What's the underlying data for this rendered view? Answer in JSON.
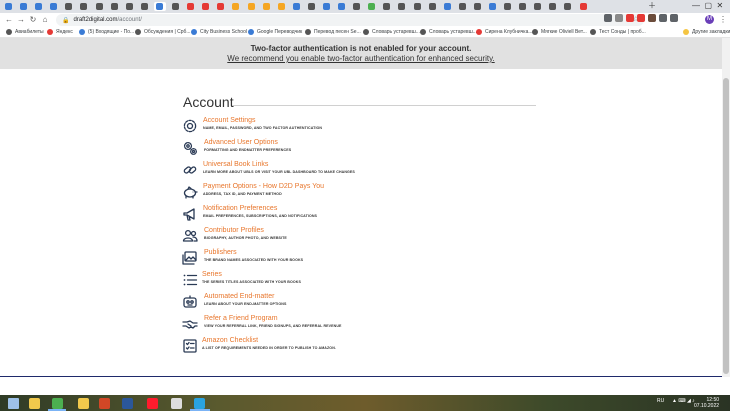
{
  "browser": {
    "url_domain": "draft2digital.com",
    "url_path": "/account/",
    "tab_colors": [
      "#3a7bd5",
      "#3a7bd5",
      "#3a7bd5",
      "#3a7bd5",
      "#555",
      "#555",
      "#555",
      "#555",
      "#555",
      "#555",
      "#3a7bd5",
      "#555",
      "#e53935",
      "#e53935",
      "#e53935",
      "#f5a623",
      "#f5a623",
      "#f5a623",
      "#f5a623",
      "#3a7bd5",
      "#555",
      "#3a7bd5",
      "#3a7bd5",
      "#555",
      "#4caf50",
      "#555",
      "#555",
      "#555",
      "#555",
      "#3a7bd5",
      "#555",
      "#555",
      "#3a7bd5",
      "#555",
      "#555",
      "#555",
      "#555",
      "#555",
      "#e53935"
    ],
    "bookmarks": [
      {
        "label": "Авиабилеты",
        "color": "#555555"
      },
      {
        "label": "Яндекс",
        "color": "#e53935"
      },
      {
        "label": "(5) Входящие - По...",
        "color": "#3a7bd5"
      },
      {
        "label": "Обсуждения | Срб...",
        "color": "#555555"
      },
      {
        "label": "City Business School",
        "color": "#3a7bd5"
      },
      {
        "label": "Google Переводчик",
        "color": "#3a7bd5"
      },
      {
        "label": "Перевод песен Se...",
        "color": "#555555"
      },
      {
        "label": "Словарь устаревш...",
        "color": "#555555"
      },
      {
        "label": "Словарь устаревш...",
        "color": "#555555"
      },
      {
        "label": "Сирена Клубничка...",
        "color": "#e53935"
      },
      {
        "label": "Мягкие Oliviell Вет...",
        "color": "#555555"
      },
      {
        "label": "Тест Сонды | проб...",
        "color": "#555555"
      },
      {
        "label": "Другие закладки",
        "color": "#f5c542"
      }
    ]
  },
  "alert": {
    "title": "Two-factor authentication is not enabled for your account.",
    "link": "We recommend you enable two-factor authentication for enhanced security."
  },
  "page_title": "Account",
  "items": [
    {
      "title": "Account Settings",
      "desc": "NAME, EMAIL, PASSWORD, AND TWO FACTOR AUTHENTICATION",
      "icon": "gear-icon"
    },
    {
      "title": "Advanced User Options",
      "desc": "FORMATTING AND ENDMATTER PREFERENCES",
      "icon": "gears-icon"
    },
    {
      "title": "Universal Book Links",
      "desc": "LEARN MORE ABOUT UBLS OR VISIT YOUR UBL DASHBOARD TO MAKE CHANGES",
      "icon": "link-icon"
    },
    {
      "title": "Payment Options - How D2D Pays You",
      "desc": "ADDRESS, TAX ID, AND PAYMENT METHOD",
      "icon": "piggy-bank-icon"
    },
    {
      "title": "Notification Preferences",
      "desc": "EMAIL PREFERENCES, SUBSCRIPTIONS, AND NOTIFICATIONS",
      "icon": "megaphone-icon"
    },
    {
      "title": "Contributor Profiles",
      "desc": "BIOGRAPHY, AUTHOR PHOTO, AND WEBSITE",
      "icon": "people-icon"
    },
    {
      "title": "Publishers",
      "desc": "THE BRAND NAMES ASSOCIATED WITH YOUR BOOKS",
      "icon": "image-icon"
    },
    {
      "title": "Series",
      "desc": "THE SERIES TITLES ASSOCIATED WITH YOUR BOOKS",
      "icon": "list-icon"
    },
    {
      "title": "Automated End-matter",
      "desc": "LEARN ABOUT YOUR END-MATTER OPTIONS",
      "icon": "robot-icon"
    },
    {
      "title": "Refer a Friend Program",
      "desc": "VIEW YOUR REFERRAL LINK, FRIEND SIGNUPS, AND REFERRAL REVENUE",
      "icon": "handshake-icon"
    },
    {
      "title": "Amazon Checklist",
      "desc": "A LIST OF REQUIREMENTS NEEDED IN ORDER TO PUBLISH TO AMAZON.",
      "icon": "checklist-icon"
    }
  ],
  "colors": {
    "accent": "#e8762c",
    "footer": "#1f2a6b",
    "alert_bg": "#e1e1e1"
  },
  "taskbar": {
    "lang": "RU",
    "time": "12:50",
    "date": "07.10.2022",
    "apps": [
      {
        "name": "start-icon",
        "color": "#9ec1e8"
      },
      {
        "name": "explorer-icon",
        "color": "#f2c94c"
      },
      {
        "name": "chrome-icon",
        "color": "#4caf50"
      },
      {
        "name": "files-icon",
        "color": "#f2c94c"
      },
      {
        "name": "powerpoint-icon",
        "color": "#d24726"
      },
      {
        "name": "word-icon",
        "color": "#2b579a"
      },
      {
        "name": "opera-icon",
        "color": "#ff1b2d"
      },
      {
        "name": "app-icon",
        "color": "#dddddd"
      },
      {
        "name": "telegram-icon",
        "color": "#2aa3e0"
      }
    ]
  }
}
